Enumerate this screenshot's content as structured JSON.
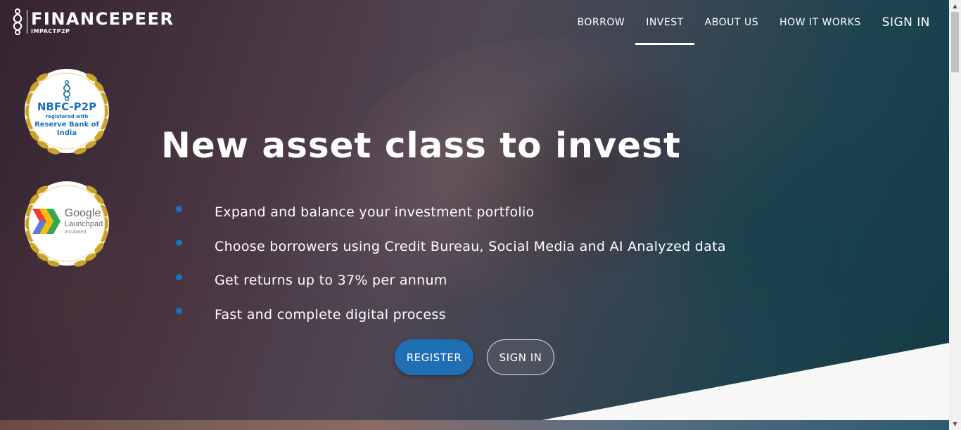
{
  "brand": {
    "name": "FINANCEPEER",
    "tagline": "IMPACTP2P"
  },
  "nav": {
    "items": [
      {
        "label": "BORROW"
      },
      {
        "label": "INVEST"
      },
      {
        "label": "ABOUT US"
      },
      {
        "label": "HOW IT WORKS"
      },
      {
        "label": "SIGN IN"
      }
    ],
    "active": "INVEST"
  },
  "badges": {
    "nbfc": {
      "title": "NBFC-P2P",
      "subtitle": "registered with",
      "authority": "Reserve Bank of India"
    },
    "google": {
      "word": "Google",
      "program": "Launchpad",
      "status": "Incubated"
    }
  },
  "hero": {
    "headline": "New asset class to invest",
    "bullets": [
      "Expand and balance your investment portfolio",
      "Choose borrowers using Credit Bureau, Social Media and AI Analyzed data",
      "Get returns up to 37% per annum",
      "Fast and complete digital process"
    ],
    "register_label": "REGISTER",
    "signin_label": "SIGN IN"
  },
  "colors": {
    "accent": "#1d71b8",
    "gold": "#c9a227",
    "white": "#ffffff"
  }
}
